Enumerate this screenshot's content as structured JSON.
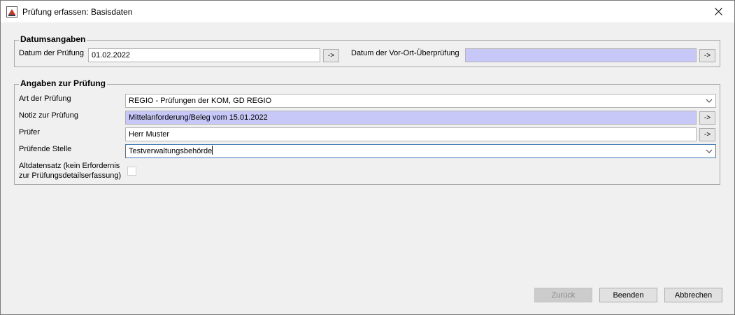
{
  "window": {
    "title": "Prüfung erfassen: Basisdaten"
  },
  "datum": {
    "group_title": "Datumsangaben",
    "datum_label": "Datum der Prüfung",
    "datum_value": "01.02.2022",
    "datum_arrow": "->",
    "vorort_label": "Datum der Vor-Ort-Überprüfung",
    "vorort_value": "",
    "vorort_arrow": "->"
  },
  "angaben": {
    "group_title": "Angaben zur Prüfung",
    "art_label": "Art der Prüfung",
    "art_value": "REGIO - Prüfungen der KOM, GD REGIO",
    "notiz_label": "Notiz zur Prüfung",
    "notiz_value": "Mittelanforderung/Beleg vom 15.01.2022",
    "notiz_arrow": "->",
    "pruefer_label": "Prüfer",
    "pruefer_value": "Herr Muster",
    "pruefer_arrow": "->",
    "stelle_label": "Prüfende Stelle",
    "stelle_value": "Testverwaltungsbehörde",
    "alt_label_line1": "Altdatensatz (kein Erfordernis",
    "alt_label_line2": "zur Prüfungsdetailserfassung)",
    "alt_checked": false
  },
  "buttons": {
    "zurueck": "Zurück",
    "beenden": "Beenden",
    "abbrechen": "Abbrechen"
  },
  "icons": {
    "app": "java-app-icon",
    "close": "close-icon",
    "dropdown": "chevron-down-icon"
  }
}
